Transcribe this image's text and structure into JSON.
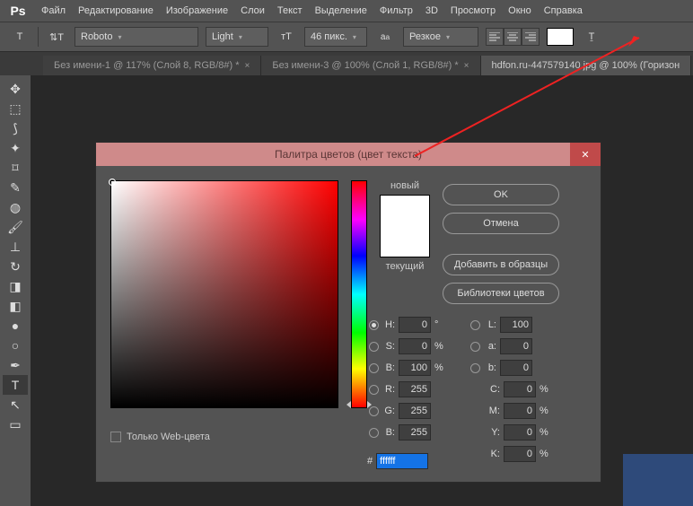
{
  "menu": {
    "items": [
      "Файл",
      "Редактирование",
      "Изображение",
      "Слои",
      "Текст",
      "Выделение",
      "Фильтр",
      "3D",
      "Просмотр",
      "Окно",
      "Справка"
    ]
  },
  "optbar": {
    "font": "Roboto",
    "weight": "Light",
    "size": "46 пикс.",
    "aa": "Резкое"
  },
  "tabs": [
    {
      "label": "Без имени-1 @ 117% (Слой 8, RGB/8#) *"
    },
    {
      "label": "Без имени-3 @ 100% (Слой 1, RGB/8#) *"
    },
    {
      "label": "hdfon.ru-447579140.jpg @ 100% (Горизон"
    }
  ],
  "picker": {
    "title": "Палитра цветов (цвет текста)",
    "new": "новый",
    "current": "текущий",
    "buttons": {
      "ok": "OK",
      "cancel": "Отмена",
      "add": "Добавить в образцы",
      "lib": "Библиотеки цветов"
    },
    "webonly": "Только Web-цвета",
    "hex": "ffffff",
    "hsb": {
      "h": "0",
      "s": "0",
      "b": "100"
    },
    "lab": {
      "l": "100",
      "a": "0",
      "b": "0"
    },
    "rgb": {
      "r": "255",
      "g": "255",
      "b": "255"
    },
    "cmyk": {
      "c": "0",
      "m": "0",
      "y": "0",
      "k": "0"
    }
  }
}
